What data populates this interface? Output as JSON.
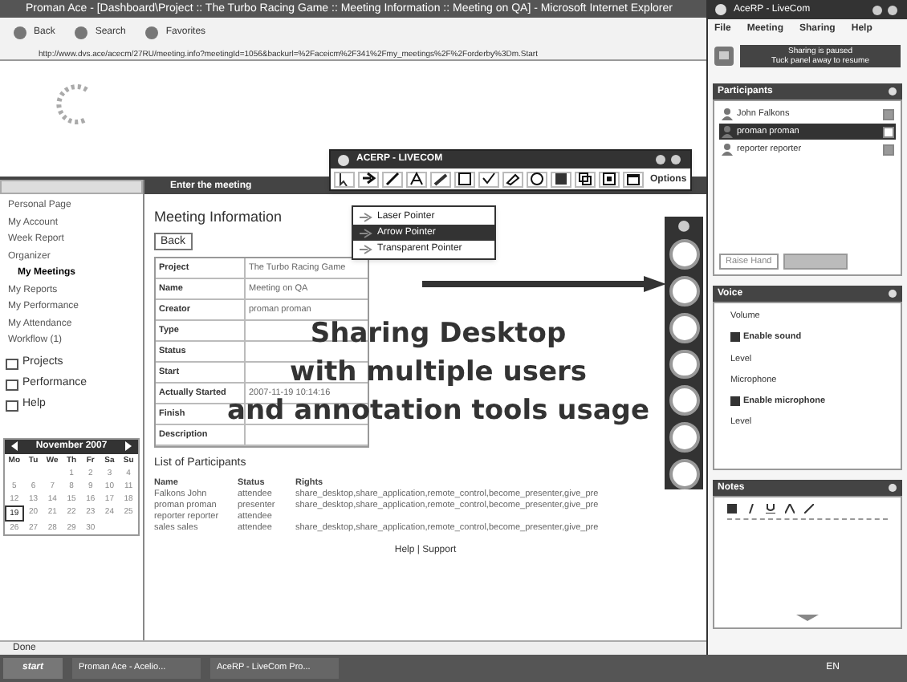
{
  "browser": {
    "title": "Proman Ace - [Dashboard\\Project :: The Turbo Racing Game :: Meeting Information :: Meeting on QA] - Microsoft Internet Explorer",
    "toolbar": [
      "Back",
      "Search",
      "Favorites"
    ],
    "address": "http://www.dvs.ace/acecm/27RU/meeting.info?meetingId=1056&backurl=%2Faceicm%2F341%2Fmy_meetings%2F%2Forderby%3Dm.Start",
    "status": "Done"
  },
  "menu": [
    {
      "label": "Personal Page",
      "selected": false
    },
    {
      "label": "My Account",
      "selected": false
    },
    {
      "label": "Week Report",
      "selected": false
    },
    {
      "label": "Organizer",
      "selected": false
    },
    {
      "label": "My Meetings",
      "selected": true
    },
    {
      "label": "My Reports",
      "selected": false
    },
    {
      "label": "My Performance",
      "selected": false
    },
    {
      "label": "My Attendance",
      "selected": false
    },
    {
      "label": "Workflow (1)",
      "selected": false
    }
  ],
  "sections": [
    "Projects",
    "Performance",
    "Help"
  ],
  "calendar": {
    "month": "November 2007",
    "weekdays": [
      "Mo",
      "Tu",
      "We",
      "Th",
      "Fr",
      "Sa",
      "Su"
    ],
    "days": [
      {
        "label": "1",
        "selected": false
      },
      {
        "label": "2",
        "selected": false
      },
      {
        "label": "3",
        "selected": false
      },
      {
        "label": "4",
        "selected": false
      },
      {
        "label": "5",
        "selected": false
      },
      {
        "label": "6",
        "selected": false
      },
      {
        "label": "7",
        "selected": false
      },
      {
        "label": "8",
        "selected": false
      },
      {
        "label": "9",
        "selected": false
      },
      {
        "label": "10",
        "selected": false
      },
      {
        "label": "11",
        "selected": false
      },
      {
        "label": "12",
        "selected": false
      },
      {
        "label": "13",
        "selected": false
      },
      {
        "label": "14",
        "selected": false
      },
      {
        "label": "15",
        "selected": false
      },
      {
        "label": "16",
        "selected": false
      },
      {
        "label": "17",
        "selected": false
      },
      {
        "label": "18",
        "selected": false
      },
      {
        "label": "19",
        "selected": true
      },
      {
        "label": "20",
        "selected": false
      },
      {
        "label": "21",
        "selected": false
      },
      {
        "label": "22",
        "selected": false
      },
      {
        "label": "23",
        "selected": false
      },
      {
        "label": "24",
        "selected": false
      },
      {
        "label": "25",
        "selected": false
      },
      {
        "label": "26",
        "selected": false
      },
      {
        "label": "27",
        "selected": false
      },
      {
        "label": "28",
        "selected": false
      },
      {
        "label": "29",
        "selected": false
      },
      {
        "label": "30",
        "selected": false
      }
    ]
  },
  "meeting": {
    "bar": "Enter the meeting",
    "title": "Meeting Information",
    "back": "Back",
    "info": [
      {
        "label": "Project",
        "value": "The Turbo Racing Game"
      },
      {
        "label": "Name",
        "value": "Meeting on QA"
      },
      {
        "label": "Creator",
        "value": "proman proman"
      },
      {
        "label": "Type"
      },
      {
        "label": "Status"
      },
      {
        "label": "Start"
      },
      {
        "label": "Actually Started",
        "value": "2007-11-19 10:14:16"
      },
      {
        "label": "Finish"
      },
      {
        "label": "Description"
      }
    ]
  },
  "participants": {
    "title": "List of Participants",
    "columns": [
      "Name",
      "Status",
      "Rights"
    ],
    "rows": [
      [
        "Falkons John",
        "attendee",
        "share_desktop,share_application,remote_control,become_presenter,give_pre"
      ],
      [
        "proman proman",
        "presenter",
        "share_desktop,share_application,remote_control,become_presenter,give_pre"
      ],
      [
        "reporter reporter",
        "attendee"
      ],
      [
        "sales sales",
        "attendee",
        "share_desktop,share_application,remote_control,become_presenter,give_pre"
      ]
    ]
  },
  "footer": "Help | Support",
  "annotation_toolbar": {
    "title": "ACERP - LIVECOM",
    "options": "Options",
    "pointers": [
      {
        "label": "Laser Pointer",
        "selected": false
      },
      {
        "label": "Arrow Pointer",
        "selected": true
      },
      {
        "label": "Transparent Pointer",
        "selected": false
      }
    ]
  },
  "caption": [
    "Sharing Desktop",
    "with multiple users",
    "and annotation tools usage"
  ],
  "livecom": {
    "title": "AceRP - LiveCom",
    "menu": [
      "File",
      "Meeting",
      "Sharing",
      "Help"
    ],
    "notice": [
      "Sharing is paused",
      "Tuck panel away to resume"
    ],
    "participants_title": "Participants",
    "participants": [
      {
        "name": "John Falkons",
        "selected": false
      },
      {
        "name": "proman proman",
        "selected": true
      },
      {
        "name": "reporter reporter",
        "selected": false
      }
    ],
    "raise_hand": "Raise Hand",
    "voice_title": "Voice",
    "voice": [
      {
        "kind": "label",
        "text": "Volume"
      },
      {
        "kind": "check",
        "text": "Enable sound",
        "checked": true
      },
      {
        "kind": "label",
        "text": "Level"
      },
      {
        "kind": "label",
        "text": "Microphone"
      },
      {
        "kind": "check",
        "text": "Enable microphone",
        "checked": true
      },
      {
        "kind": "label",
        "text": "Level"
      }
    ],
    "notes_title": "Notes"
  },
  "taskbar": {
    "start": "start",
    "tasks": [
      "Proman Ace - Acelio...",
      "AceRP - LiveCom Pro..."
    ],
    "tray": "EN"
  }
}
